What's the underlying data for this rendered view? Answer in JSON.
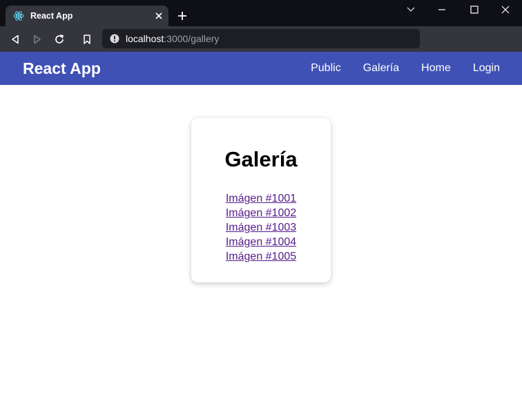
{
  "browser": {
    "tab": {
      "title": "React App",
      "favicon": "react-logo-icon"
    },
    "address_bar": {
      "host": "localhost",
      "path": ":3000/gallery"
    },
    "colors": {
      "tabstrip_bg": "#0f0f16",
      "toolbar_bg": "#34353d",
      "omnibox_bg": "#1d1e24"
    }
  },
  "navbar": {
    "brand": "React App",
    "links": [
      {
        "label": "Public"
      },
      {
        "label": "Galería"
      },
      {
        "label": "Home"
      },
      {
        "label": "Login"
      }
    ],
    "color": "#3f51b5"
  },
  "gallery": {
    "title": "Galería",
    "items": [
      {
        "label": "Imágen #1001"
      },
      {
        "label": "Imágen #1002"
      },
      {
        "label": "Imágen #1003"
      },
      {
        "label": "Imágen #1004"
      },
      {
        "label": "Imágen #1005"
      }
    ],
    "link_color": "#551a8b"
  }
}
